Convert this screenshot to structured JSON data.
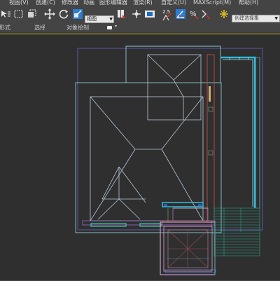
{
  "menubar": {
    "items": [
      {
        "label": "视图(V)"
      },
      {
        "label": "创建(C)"
      },
      {
        "label": "修改器"
      },
      {
        "label": "动画"
      },
      {
        "label": "图形编辑器"
      },
      {
        "label": "渲染(R)"
      },
      {
        "label": "自定义(U)"
      },
      {
        "label": "MAXScript(M)"
      },
      {
        "label": "帮助(H)"
      }
    ]
  },
  "toolbar": {
    "reference_coord": "视图",
    "angle_snap": "2.5",
    "percent_snap": "%",
    "named_selection_placeholder": "创建选择集"
  },
  "ribbon": {
    "items": [
      {
        "label": "形式"
      },
      {
        "label": "选择"
      },
      {
        "label": "对象绘制"
      }
    ]
  },
  "viewport": {
    "active_border_color": "#b8a200",
    "background": "#2f2f2f"
  }
}
